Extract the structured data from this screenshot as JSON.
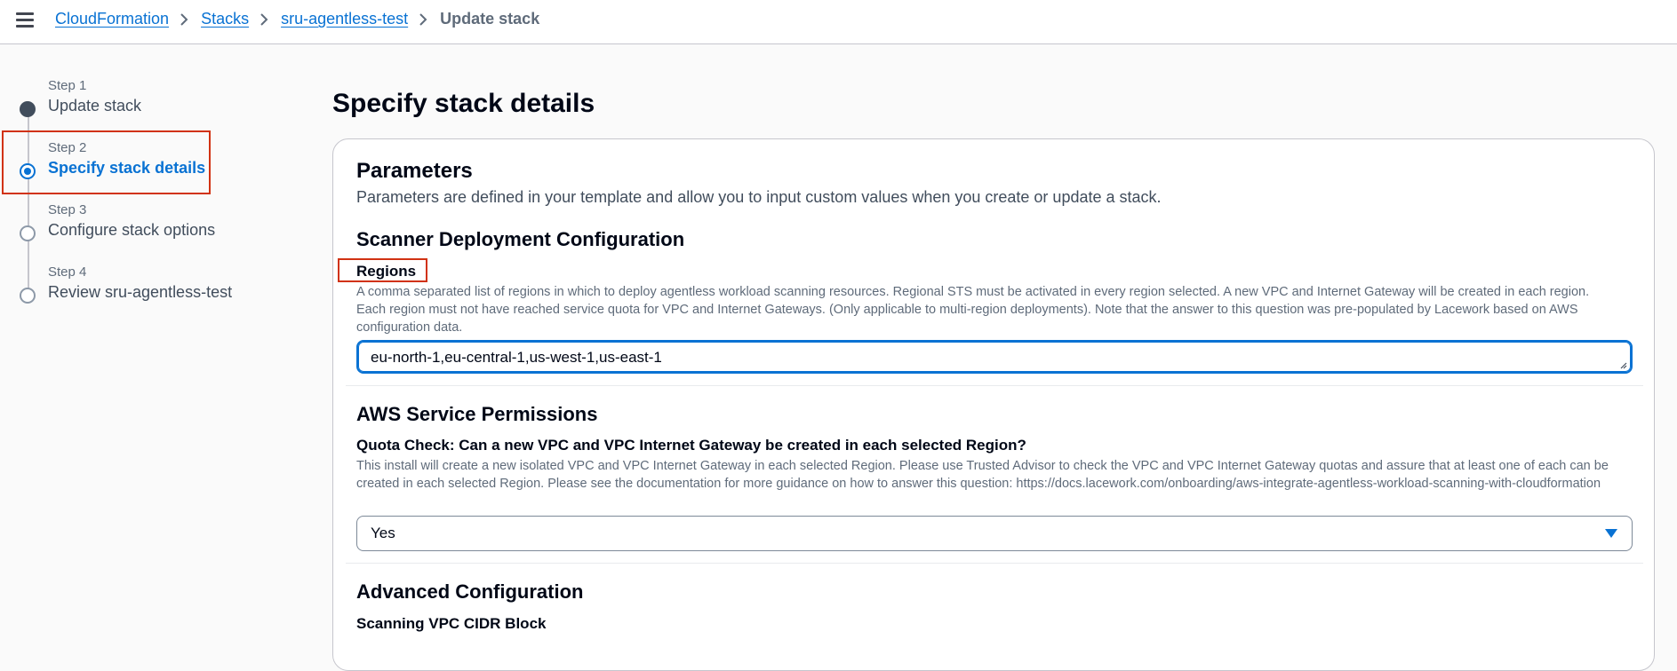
{
  "breadcrumb": {
    "items": [
      "CloudFormation",
      "Stacks",
      "sru-agentless-test"
    ],
    "current": "Update stack"
  },
  "steps": [
    {
      "num": "Step 1",
      "title": "Update stack",
      "state": "done"
    },
    {
      "num": "Step 2",
      "title": "Specify stack details",
      "state": "active"
    },
    {
      "num": "Step 3",
      "title": "Configure stack options",
      "state": "pending"
    },
    {
      "num": "Step 4",
      "title": "Review sru-agentless-test",
      "state": "pending"
    }
  ],
  "page": {
    "title": "Specify stack details"
  },
  "parameters": {
    "title": "Parameters",
    "description": "Parameters are defined in your template and allow you to input custom values when you create or update a stack."
  },
  "scanner": {
    "title": "Scanner Deployment Configuration",
    "regions_label": "Regions",
    "regions_help": "A comma separated list of regions in which to deploy agentless workload scanning resources. Regional STS must be activated in every region selected. A new VPC and Internet Gateway will be created in each region. Each region must not have reached service quota for VPC and Internet Gateways. (Only applicable to multi-region deployments). Note that the answer to this question was pre-populated by Lacework based on AWS configuration data.",
    "regions_value": "eu-north-1,eu-central-1,us-west-1,us-east-1"
  },
  "permissions": {
    "title": "AWS Service Permissions",
    "quota_label": "Quota Check: Can a new VPC and VPC Internet Gateway be created in each selected Region?",
    "quota_help": "This install will create a new isolated VPC and VPC Internet Gateway in each selected Region. Please use Trusted Advisor to check the VPC and VPC Internet Gateway quotas and assure that at least one of each can be created in each selected Region. Please see the documentation for more guidance on how to answer this question: https://docs.lacework.com/onboarding/aws-integrate-agentless-workload-scanning-with-cloudformation",
    "quota_value": "Yes"
  },
  "advanced": {
    "title": "Advanced Configuration",
    "cidr_label": "Scanning VPC CIDR Block"
  },
  "colors": {
    "accent": "#0972d3",
    "highlight": "#d13212"
  }
}
